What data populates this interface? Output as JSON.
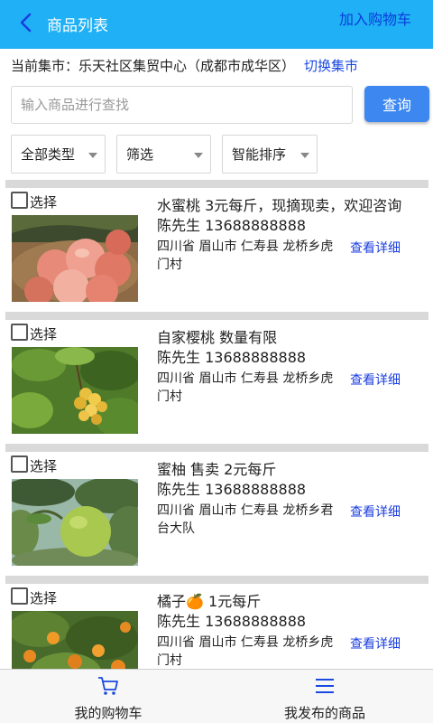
{
  "header": {
    "title": "商品列表",
    "action_label": "加入购物车",
    "back_icon": "back-arrow-icon",
    "bg_color": "#1fb0f5"
  },
  "market": {
    "prefix": "当前集市：",
    "name": "乐天社区集贸中心（成都市成华区）",
    "switch_label": "切换集市"
  },
  "search": {
    "placeholder": "输入商品进行查找",
    "value": "",
    "button_label": "查询"
  },
  "filters": {
    "type_label": "全部类型",
    "filter_label": "筛选",
    "sort_label": "智能排序"
  },
  "items": [
    {
      "checkbox_label": "选择",
      "checked": false,
      "title": "水蜜桃 3元每斤，现摘现卖，欢迎咨询",
      "contact": "陈先生 13688888888",
      "address": "四川省 眉山市 仁寿县 龙桥乡虎门村",
      "detail_label": "查看详细",
      "image": "peach-photo"
    },
    {
      "checkbox_label": "选择",
      "checked": false,
      "title": "自家樱桃 数量有限",
      "contact": "陈先生 13688888888",
      "address": "四川省 眉山市 仁寿县 龙桥乡虎门村",
      "detail_label": "查看详细",
      "image": "cherry-photo"
    },
    {
      "checkbox_label": "选择",
      "checked": false,
      "title": "蜜柚 售卖 2元每斤",
      "contact": "陈先生 13688888888",
      "address": "四川省 眉山市 仁寿县 龙桥乡君台大队",
      "detail_label": "查看详细",
      "image": "pomelo-photo"
    },
    {
      "checkbox_label": "选择",
      "checked": false,
      "title": "橘子🍊 1元每斤",
      "contact": "陈先生 13688888888",
      "address": "四川省 眉山市 仁寿县 龙桥乡虎门村",
      "detail_label": "查看详细",
      "image": "tangerine-photo"
    }
  ],
  "bottom_nav": {
    "cart_label": "我的购物车",
    "cart_icon": "cart-icon",
    "mine_label": "我发布的商品",
    "mine_icon": "list-icon"
  }
}
